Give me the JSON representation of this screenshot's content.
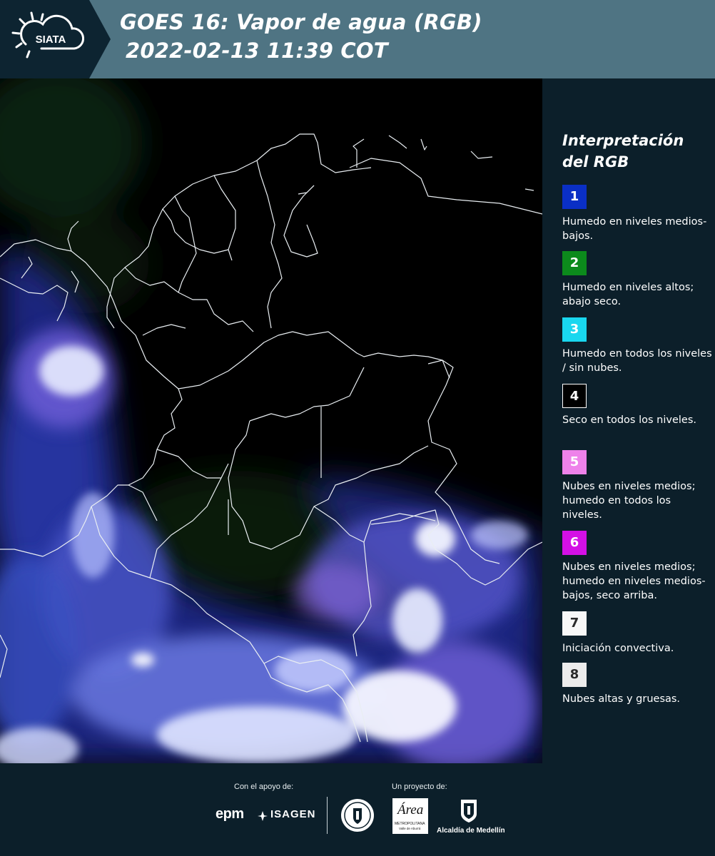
{
  "header": {
    "logo_text": "SIATA",
    "title_line1": "GOES 16: Vapor de agua (RGB)",
    "title_line2": "2022-02-13 11:39 COT"
  },
  "legend": {
    "title": "Interpretación del RGB",
    "items": [
      {
        "number": "1",
        "color": "#0a2fc6",
        "text_color": "#ffffff",
        "description": "Humedo en niveles medios-bajos."
      },
      {
        "number": "2",
        "color": "#0c8a1c",
        "text_color": "#ffffff",
        "description": "Humedo en niveles altos; abajo seco."
      },
      {
        "number": "3",
        "color": "#19d7ef",
        "text_color": "#ffffff",
        "description": "Humedo en todos los niveles / sin nubes."
      },
      {
        "number": "4",
        "color": "#000000",
        "text_color": "#ffffff",
        "description": "Seco en todos los niveles."
      },
      {
        "number": "5",
        "color": "#ee82ea",
        "text_color": "#ffffff",
        "description": "Nubes en niveles medios; humedo en todos los niveles."
      },
      {
        "number": "6",
        "color": "#d410e6",
        "text_color": "#ffffff",
        "description": "Nubes en niveles medios; humedo en niveles medios-bajos, seco arriba."
      },
      {
        "number": "7",
        "color": "#f7f7f7",
        "text_color": "#2a2a2a",
        "description": "Iniciación convectiva."
      },
      {
        "number": "8",
        "color": "#ececec",
        "text_color": "#2a2a2a",
        "description": "Nubes altas y gruesas."
      }
    ]
  },
  "footer": {
    "support_caption": "Con el apoyo de:",
    "project_caption": "Un proyecto de:",
    "logos": {
      "epm": "epm",
      "isagen": "ISAGEN",
      "area_script": "Área",
      "area_line1": "METROPOLITANA",
      "area_line2": "Valle de Aburrá",
      "medellin": "Alcaldía de Medellín"
    }
  }
}
